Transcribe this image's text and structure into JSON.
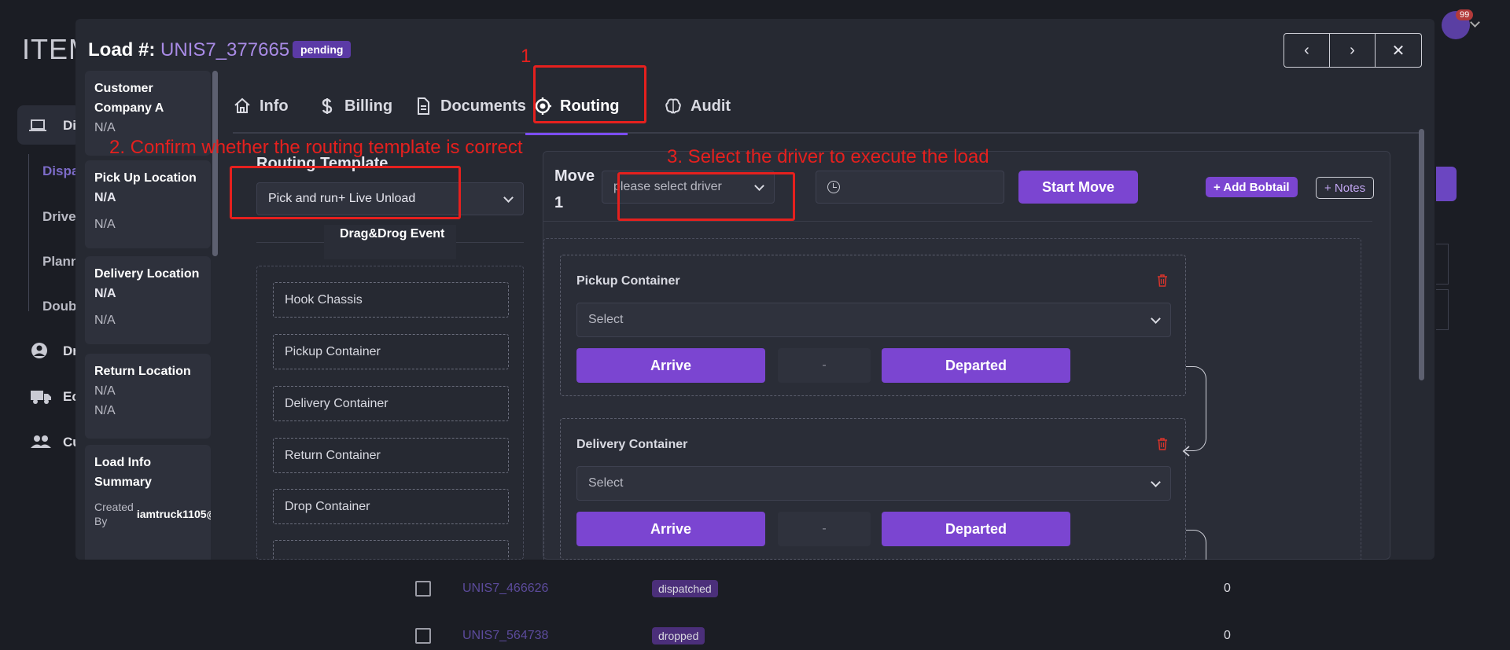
{
  "background": {
    "app_title": "ITEM",
    "nav": {
      "dispatch": "Di",
      "dispatcher_sub": "Dispa",
      "drivers_sub": "Drive",
      "planner_sub": "Plann",
      "double_sub": "Doub",
      "drivers": "Dr",
      "equipment": "Ec",
      "customers": "Cu"
    },
    "notification_count": "99",
    "rows": [
      {
        "id": "UNIS7_466626",
        "status": "dispatched",
        "count": "0"
      },
      {
        "id": "UNIS7_564738",
        "status": "dropped",
        "count": "0"
      }
    ]
  },
  "modal": {
    "load_label": "Load #:",
    "load_id": "UNIS7_377665",
    "status": "pending",
    "nav": {
      "prev": "‹",
      "next": "›",
      "close": "✕"
    },
    "info": {
      "customer": {
        "name": "Customer Company A",
        "value": "N/A"
      },
      "pickup": {
        "title": "Pick Up Location",
        "value": "N/A",
        "sub": "N/A"
      },
      "delivery": {
        "title": "Delivery Location",
        "value": "N/A",
        "sub": "N/A"
      },
      "return": {
        "title": "Return Location",
        "value": "N/A",
        "sub": "N/A"
      },
      "summary": {
        "title": "Load Info Summary",
        "created_by_label": "Created By",
        "created_by_value": "iamtruck1105@"
      }
    },
    "tabs": [
      {
        "label": "Info",
        "icon": "home-icon"
      },
      {
        "label": "Billing",
        "icon": "dollar-icon"
      },
      {
        "label": "Documents",
        "icon": "document-icon"
      },
      {
        "label": "Routing",
        "icon": "target-icon"
      },
      {
        "label": "Audit",
        "icon": "brain-icon"
      }
    ],
    "routing": {
      "template_label": "Routing Template",
      "template_value": "Pick and run+ Live Unload",
      "drag_drop_label": "Drag&Drog Event",
      "events": [
        "Hook Chassis",
        "Pickup Container",
        "Delivery Container",
        "Return Container",
        "Drop Container"
      ],
      "move_label": "Move 1",
      "driver_placeholder": "please select driver",
      "start_move": "Start Move",
      "add_bobtail": "+ Add Bobtail",
      "notes": "+ Notes",
      "cards": [
        {
          "title": "Pickup Container",
          "select": "Select",
          "arrive": "Arrive",
          "dash": "-",
          "departed": "Departed"
        },
        {
          "title": "Delivery Container",
          "select": "Select",
          "arrive": "Arrive",
          "dash": "-",
          "departed": "Departed"
        }
      ]
    }
  },
  "annotations": {
    "step1": "1",
    "step2": "2. Confirm whether the routing template is correct",
    "step3": "3. Select the driver to execute the load"
  },
  "colors": {
    "accent": "#7b45d1",
    "annotation": "#e5201e",
    "load_id": "#a98be6"
  }
}
